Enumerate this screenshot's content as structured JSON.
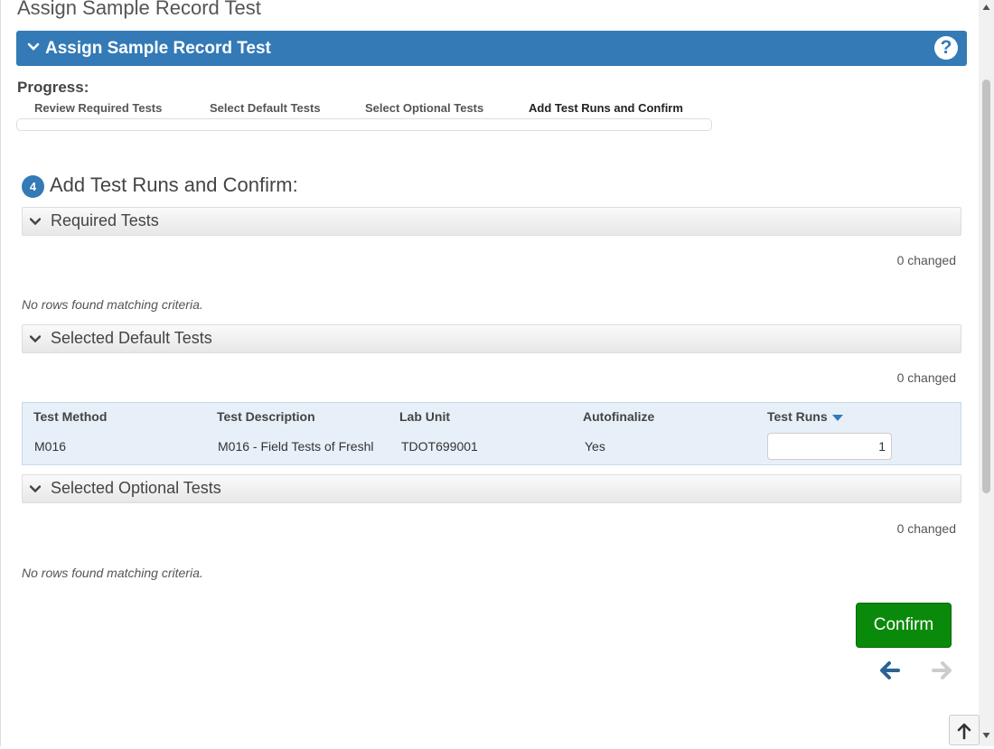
{
  "page": {
    "title": "Assign Sample Record Test"
  },
  "header": {
    "title": "Assign Sample Record Test",
    "help_icon": "question-circle-icon",
    "help_glyph": "?"
  },
  "progress": {
    "label": "Progress:",
    "steps": [
      "Review Required Tests",
      "Select Default Tests",
      "Select Optional Tests",
      "Add Test Runs and Confirm"
    ]
  },
  "step": {
    "number": "4",
    "title": "Add Test Runs and Confirm:"
  },
  "required": {
    "title": "Required Tests",
    "changed": "0 changed",
    "empty": "No rows found matching criteria."
  },
  "default_tests": {
    "title": "Selected Default Tests",
    "changed": "0 changed",
    "columns": [
      "Test Method",
      "Test Description",
      "Lab Unit",
      "Autofinalize",
      "Test Runs"
    ],
    "rows": [
      {
        "method": "M016",
        "description": "M016 - Field Tests of Freshl",
        "lab_unit": "TDOT699001",
        "autofinalize": "Yes",
        "test_runs": "1"
      }
    ]
  },
  "optional": {
    "title": "Selected Optional Tests",
    "changed": "0 changed",
    "empty": "No rows found matching criteria."
  },
  "actions": {
    "confirm_label": "Confirm"
  },
  "colors": {
    "header_blue": "#337ab7",
    "confirm_green": "#0a8a0a",
    "nav_active": "#2a6496",
    "nav_disabled": "#cccccc"
  }
}
